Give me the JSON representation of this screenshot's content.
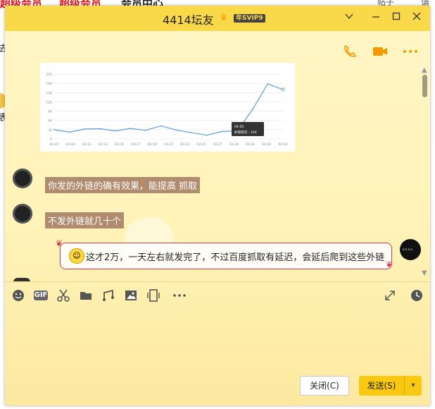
{
  "background_app": {
    "left_red1": "超级会员",
    "left_red2": "超级会员",
    "middle": "会员中心",
    "right1": "帖子",
    "right2": "请",
    "side1": "去",
    "side2": "表"
  },
  "window": {
    "title": "4414坛友",
    "vip_badge": "年SVIP9",
    "controls": {
      "collapse": "chevron-down",
      "minimize": "minimize",
      "maximize": "maximize",
      "close": "close"
    }
  },
  "top_actions": [
    {
      "name": "voice-call-icon",
      "glyph": "✆"
    },
    {
      "name": "video-call-icon",
      "glyph": "■"
    },
    {
      "name": "more-icon",
      "glyph": "•••"
    }
  ],
  "chart_data": {
    "type": "line",
    "x": [
      "03-07",
      "03-09",
      "03-11",
      "03-13",
      "03-15",
      "03-17",
      "03-19",
      "03-21",
      "03-23",
      "03-25",
      "03-27",
      "03-29",
      "03-31",
      "04-02",
      "04-04"
    ],
    "y_ticks": [
      0,
      30,
      60,
      90,
      120,
      150,
      180,
      210
    ],
    "ylim": [
      0,
      210
    ],
    "series": [
      {
        "values": [
          30,
          22,
          32,
          33,
          26,
          34,
          28,
          42,
          29,
          20,
          12,
          24,
          26,
          95,
          178,
          160
        ]
      }
    ],
    "tooltip": {
      "date": "04-05",
      "label": "抓取频次：164"
    },
    "color": "#5b9bd5"
  },
  "messages": [
    {
      "side": "left",
      "text": "你发的外链的确有效果，能提高 抓取"
    },
    {
      "side": "left",
      "text": "不发外链就几十个"
    },
    {
      "side": "right",
      "text": "这才2万，一天左右就发完了，不过百度抓取有延迟，会延后爬到这些外链"
    }
  ],
  "input_toolbar": [
    {
      "name": "emoji-icon",
      "glyph": "☺"
    },
    {
      "name": "gif-icon",
      "glyph": "GIF"
    },
    {
      "name": "scissors-icon",
      "glyph": "✂"
    },
    {
      "name": "folder-icon",
      "glyph": "▬"
    },
    {
      "name": "music-icon",
      "glyph": "♫"
    },
    {
      "name": "image-icon",
      "glyph": "▣"
    },
    {
      "name": "screen-record-icon",
      "glyph": "▯"
    },
    {
      "name": "more-tools-icon",
      "glyph": "•••"
    }
  ],
  "input_right": [
    {
      "name": "expand-icon",
      "glyph": "⤢"
    },
    {
      "name": "history-clock-icon",
      "glyph": "◷"
    }
  ],
  "buttons": {
    "close": "关闭(C)",
    "send": "发送(S)",
    "send_dropdown": "▾"
  },
  "self_avatar_text": "o n a a"
}
